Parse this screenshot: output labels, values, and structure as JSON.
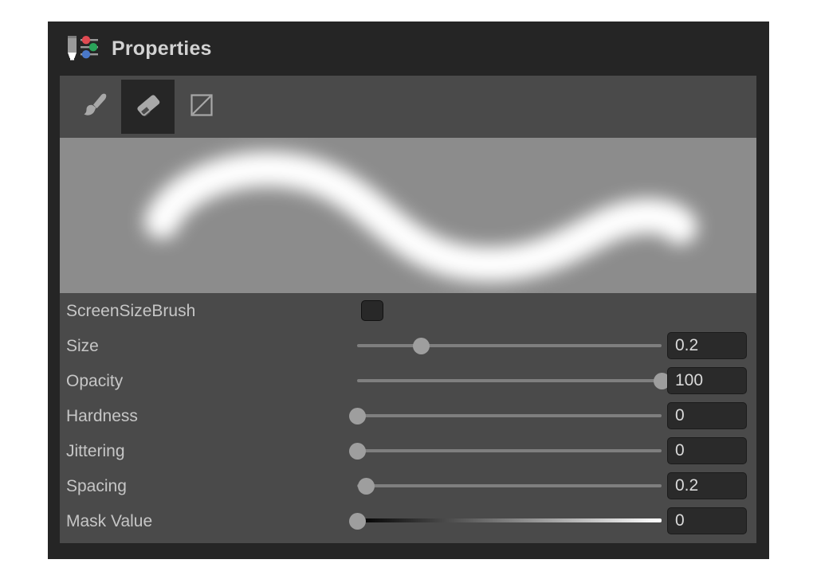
{
  "panel": {
    "title": "Properties",
    "title_icon": "brush-sliders-icon",
    "colors": {
      "panel_bg": "#252525",
      "content_bg": "#4a4a4a",
      "preview_bg": "#8c8c8c",
      "selected_tool_bg": "#262626",
      "text": "#c6c6c6",
      "knob": "#9e9e9e",
      "track": "#7f7f7f",
      "field_bg": "#2a2a2a",
      "icon_red": "#e04a52",
      "icon_green": "#2aa45a",
      "icon_blue": "#4a78c8"
    }
  },
  "toolbar": {
    "tools": [
      {
        "name": "brush-tool",
        "icon": "brush-icon",
        "selected": false
      },
      {
        "name": "eraser-tool",
        "icon": "eraser-icon",
        "selected": true
      },
      {
        "name": "no-fill-tool",
        "icon": "square-diagonal-icon",
        "selected": false
      }
    ]
  },
  "preview": {
    "name": "brush-stroke-preview",
    "description": "soft white s-curve brush stroke on gray background",
    "stroke_color": "#ffffff",
    "background_color": "#8c8c8c"
  },
  "properties": [
    {
      "label": "ScreenSizeBrush",
      "control": "checkbox",
      "checked": false
    },
    {
      "label": "Size",
      "control": "slider",
      "value": "0.2",
      "percent": 21
    },
    {
      "label": "Opacity",
      "control": "slider",
      "value": "100",
      "percent": 100
    },
    {
      "label": "Hardness",
      "control": "slider",
      "value": "0",
      "percent": 0
    },
    {
      "label": "Jittering",
      "control": "slider",
      "value": "0",
      "percent": 0
    },
    {
      "label": "Spacing",
      "control": "slider",
      "value": "0.2",
      "percent": 3
    },
    {
      "label": "Mask Value",
      "control": "slider-gradient",
      "value": "0",
      "percent": 0
    }
  ]
}
